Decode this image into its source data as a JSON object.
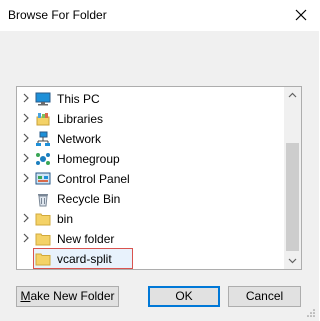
{
  "window": {
    "title": "Browse For Folder",
    "close_icon": "close-icon"
  },
  "tree": {
    "items": [
      {
        "label": "This PC",
        "icon": "monitor-icon",
        "expandable": true
      },
      {
        "label": "Libraries",
        "icon": "libraries-icon",
        "expandable": true
      },
      {
        "label": "Network",
        "icon": "network-icon",
        "expandable": true
      },
      {
        "label": "Homegroup",
        "icon": "homegroup-icon",
        "expandable": true
      },
      {
        "label": "Control Panel",
        "icon": "control-panel-icon",
        "expandable": true
      },
      {
        "label": "Recycle Bin",
        "icon": "recycle-bin-icon",
        "expandable": false
      },
      {
        "label": "bin",
        "icon": "folder-icon",
        "expandable": true
      },
      {
        "label": "New folder",
        "icon": "folder-icon",
        "expandable": true
      },
      {
        "label": "vcard-split",
        "icon": "folder-icon",
        "expandable": false,
        "selected": true
      }
    ]
  },
  "buttons": {
    "make_new_folder_mnemonic": "M",
    "make_new_folder_rest": "ake New Folder",
    "ok": "OK",
    "cancel": "Cancel"
  },
  "colors": {
    "folder": "#f4d267",
    "accent": "#0078d7",
    "selection_border": "#d9534f"
  }
}
